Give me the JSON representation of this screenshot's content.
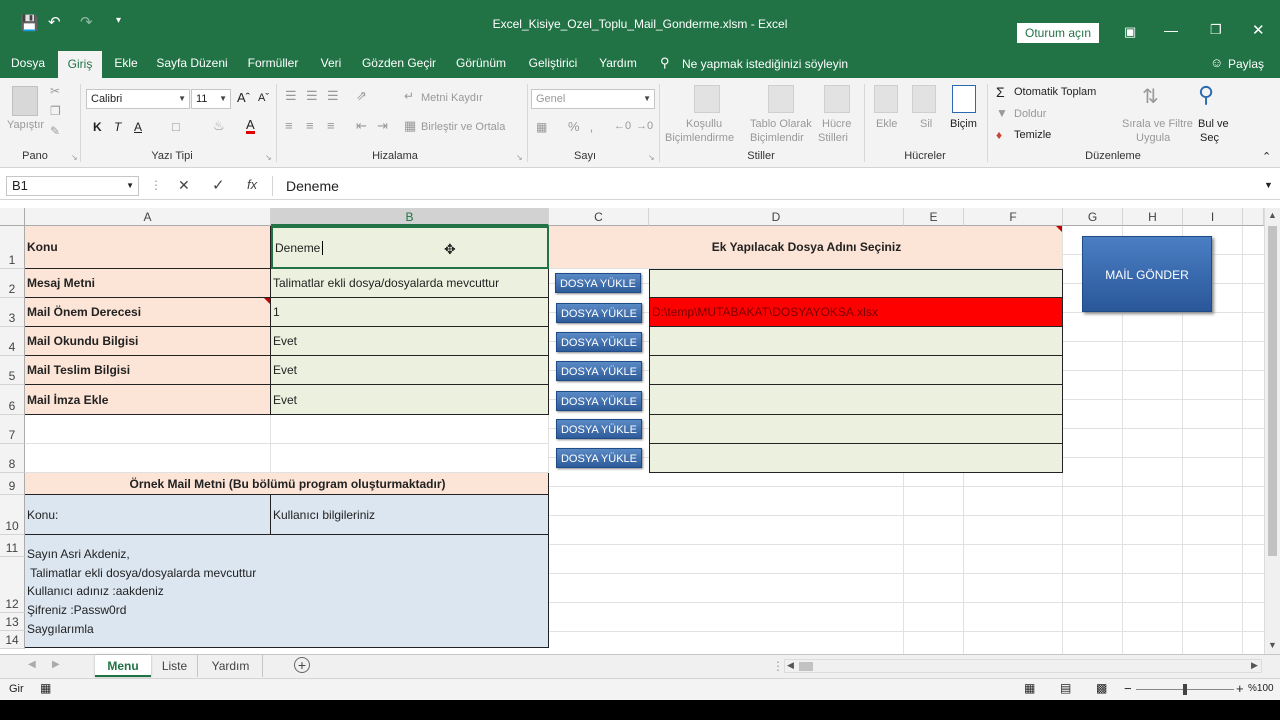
{
  "app": {
    "window_title": "Excel_Kisiye_Ozel_Toplu_Mail_Gonderme.xlsm  -  Excel",
    "signin_label": "Oturum açın",
    "share_label": "Paylaş",
    "tell_me": "Ne yapmak istediğinizi söyleyin"
  },
  "ribbon_tabs": [
    "Dosya",
    "Giriş",
    "Ekle",
    "Sayfa Düzeni",
    "Formüller",
    "Veri",
    "Gözden Geçir",
    "Görünüm",
    "Geliştirici",
    "Yardım"
  ],
  "ribbon": {
    "clipboard": {
      "paste": "Yapıştır",
      "label": "Pano"
    },
    "font": {
      "name": "Calibri",
      "size": "11",
      "bold": "K",
      "italic": "T",
      "underline": "A",
      "label": "Yazı Tipi"
    },
    "alignment": {
      "wrap": "Metni Kaydır",
      "merge": "Birleştir ve Ortala",
      "label": "Hizalama"
    },
    "number": {
      "format": "Genel",
      "label": "Sayı"
    },
    "styles": {
      "conditional": [
        "Koşullu",
        "Biçimlendirme"
      ],
      "table": [
        "Tablo Olarak",
        "Biçimlendir"
      ],
      "cell": [
        "Hücre",
        "Stilleri"
      ],
      "label": "Stiller"
    },
    "cells": {
      "insert": "Ekle",
      "delete": "Sil",
      "format": "Biçim",
      "label": "Hücreler"
    },
    "editing": {
      "autosum": "Otomatik Toplam",
      "fill": "Doldur",
      "clear": "Temizle",
      "sort": [
        "Sırala ve Filtre",
        "Uygula"
      ],
      "find": [
        "Bul ve",
        "Seç"
      ],
      "label": "Düzenleme"
    }
  },
  "formula_bar": {
    "name_box": "B1",
    "content": "Deneme"
  },
  "columns": [
    "A",
    "B",
    "C",
    "D",
    "E",
    "F",
    "G",
    "H",
    "I"
  ],
  "rows": [
    "1",
    "2",
    "3",
    "4",
    "5",
    "6",
    "7",
    "8",
    "9",
    "10",
    "11",
    "12",
    "13",
    "14"
  ],
  "sheet": {
    "labels": [
      "Konu",
      "Mesaj Metni",
      "Mail Önem Derecesi",
      "Mail Okundu Bilgisi",
      "Mail Teslim Bilgisi",
      "Mail İmza Ekle"
    ],
    "values": [
      "Deneme",
      "Talimatlar ekli dosya/dosyalarda mevcuttur",
      "1",
      "Evet",
      "Evet",
      "Evet"
    ],
    "attach_header": "Ek Yapılacak Dosya Adını Seçiniz",
    "attach_path": "D:\\temp\\MUTABAKAT\\DOSYAYOKSA.xlsx",
    "upload_button": "DOSYA YÜKLE",
    "upload_count": 7,
    "mail_button": "MAİL GÖNDER",
    "sample_header": "Örnek Mail Metni (Bu bölümü program oluşturmaktadır)",
    "sample_subject_label": "Konu:",
    "sample_subject_value": "Kullanıcı bilgileriniz",
    "sample_body": [
      "Sayın Asri Akdeniz,",
      " Talimatlar ekli dosya/dosyalarda mevcuttur",
      "Kullanıcı adınız :aakdeniz",
      "Şifreniz :Passw0rd",
      "Saygılarımla"
    ]
  },
  "sheet_tabs": [
    "Menu",
    "Liste",
    "Yardım"
  ],
  "status": {
    "mode": "Gir",
    "zoom": "%100"
  },
  "colors": {
    "excel_green": "#217346",
    "peach": "#fce4d6",
    "green_cell": "#ebf1de",
    "blue_cell": "#dce6f1",
    "error_red": "#ff0000"
  }
}
